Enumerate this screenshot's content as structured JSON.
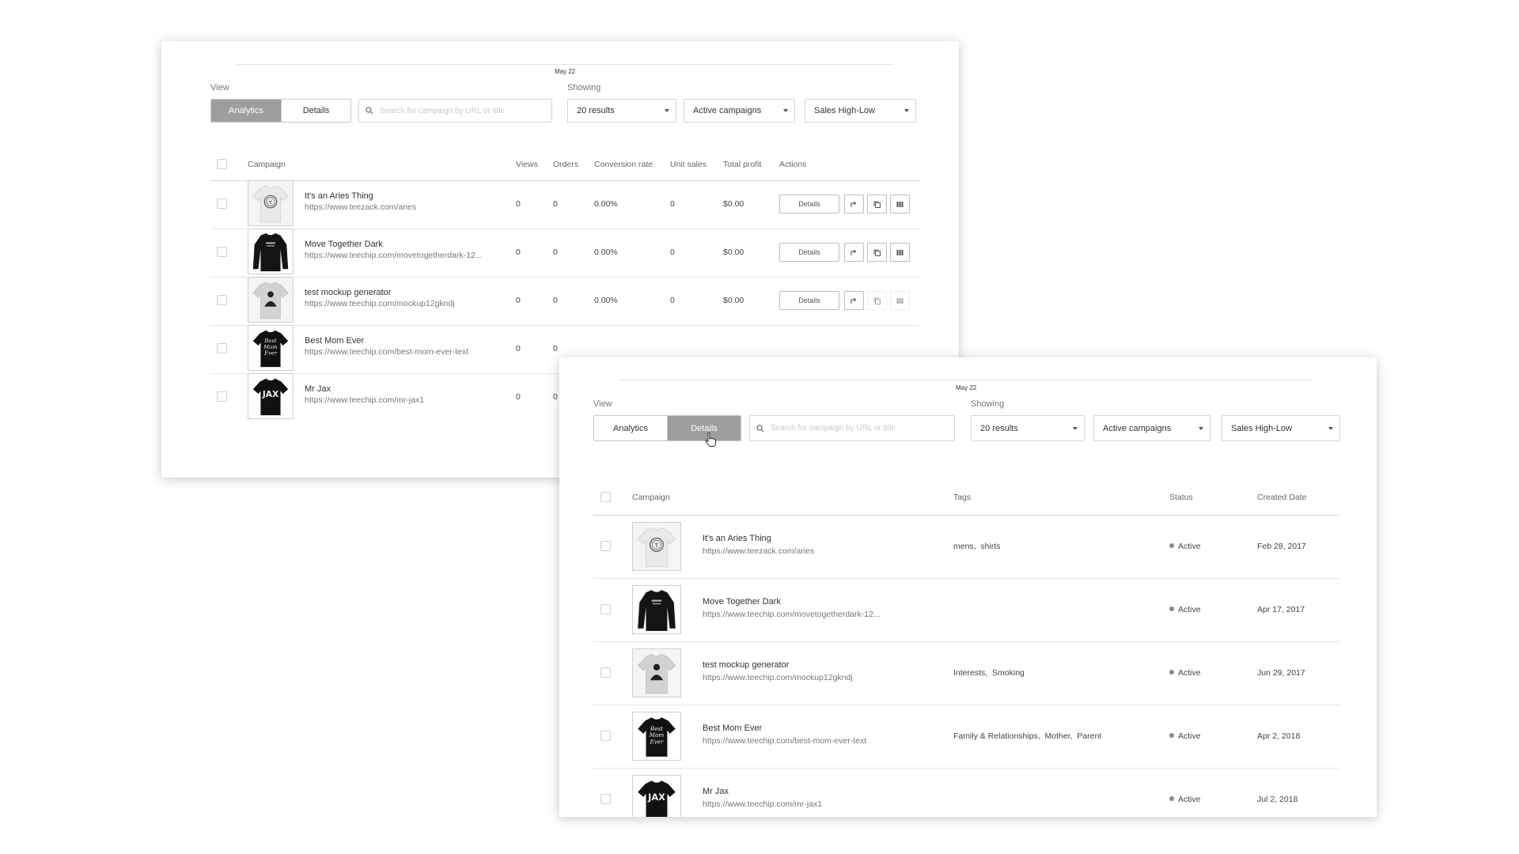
{
  "colors": {
    "active_segment": "#9e9e9e",
    "status_dot": "#8a8a8a"
  },
  "analytics_panel": {
    "date_label": "May 22",
    "view_label": "View",
    "showing_label": "Showing",
    "tabs": [
      {
        "label": "Analytics",
        "active": true
      },
      {
        "label": "Details",
        "active": false
      }
    ],
    "search_placeholder": "Search for campaign by URL or title",
    "filters": {
      "results": "20 results",
      "campaigns": "Active campaigns",
      "sort": "Sales High-Low"
    },
    "columns": {
      "campaign": "Campaign",
      "views": "Views",
      "orders": "Orders",
      "conversion": "Conversion rate",
      "unit_sales": "Unit sales",
      "profit": "Total profit",
      "actions": "Actions"
    },
    "details_button_label": "Details",
    "rows": [
      {
        "name": "It's an Aries Thing",
        "url": "https://www.teezack.com/aries",
        "views": "0",
        "orders": "0",
        "conversion": "0.00%",
        "unit_sales": "0",
        "profit": "$0.00",
        "shirt": "aries"
      },
      {
        "name": "Move Together Dark",
        "url": "https://www.teechip.com/movetogetherdark-12...",
        "views": "0",
        "orders": "0",
        "conversion": "0.00%",
        "unit_sales": "0",
        "profit": "$0.00",
        "shirt": "longsleeve"
      },
      {
        "name": "test mockup generator",
        "url": "https://www.teechip.com/mockup12gkndj",
        "views": "0",
        "orders": "0",
        "conversion": "0.00%",
        "unit_sales": "0",
        "profit": "$0.00",
        "shirt": "mockup"
      },
      {
        "name": "Best Mom Ever",
        "url": "https://www.teechip.com/best-mom-ever-text",
        "views": "0",
        "orders": "0",
        "shirt": "mom"
      },
      {
        "name": "Mr Jax",
        "url": "https://www.teechip.com/mr-jax1",
        "views": "0",
        "orders": "0",
        "shirt": "jax"
      }
    ]
  },
  "details_panel": {
    "date_label": "May 22",
    "view_label": "View",
    "showing_label": "Showing",
    "tabs": [
      {
        "label": "Analytics",
        "active": false
      },
      {
        "label": "Details",
        "active": true
      }
    ],
    "search_placeholder": "Search for campaign by URL or title",
    "filters": {
      "results": "20 results",
      "campaigns": "Active campaigns",
      "sort": "Sales High-Low"
    },
    "columns": {
      "campaign": "Campaign",
      "tags": "Tags",
      "status": "Status",
      "created": "Created Date"
    },
    "rows": [
      {
        "name": "It's an Aries Thing",
        "url": "https://www.teezack.com/aries",
        "tags": "mens,  shirts",
        "status": "Active",
        "created": "Feb 28, 2017",
        "shirt": "aries"
      },
      {
        "name": "Move Together Dark",
        "url": "https://www.teechip.com/movetogetherdark-12...",
        "tags": "",
        "status": "Active",
        "created": "Apr 17, 2017",
        "shirt": "longsleeve"
      },
      {
        "name": "test mockup generator",
        "url": "https://www.teechip.com/mockup12gkndj",
        "tags": "Interests,  Smoking",
        "status": "Active",
        "created": "Jun 29, 2017",
        "shirt": "mockup"
      },
      {
        "name": "Best Mom Ever",
        "url": "https://www.teechip.com/best-mom-ever-text",
        "tags": "Family & Relationships,  Mother,  Parent",
        "status": "Active",
        "created": "Apr 2, 2018",
        "shirt": "mom"
      },
      {
        "name": "Mr Jax",
        "url": "https://www.teechip.com/mr-jax1",
        "tags": "",
        "status": "Active",
        "created": "Jul 2, 2018",
        "shirt": "jax"
      }
    ]
  }
}
